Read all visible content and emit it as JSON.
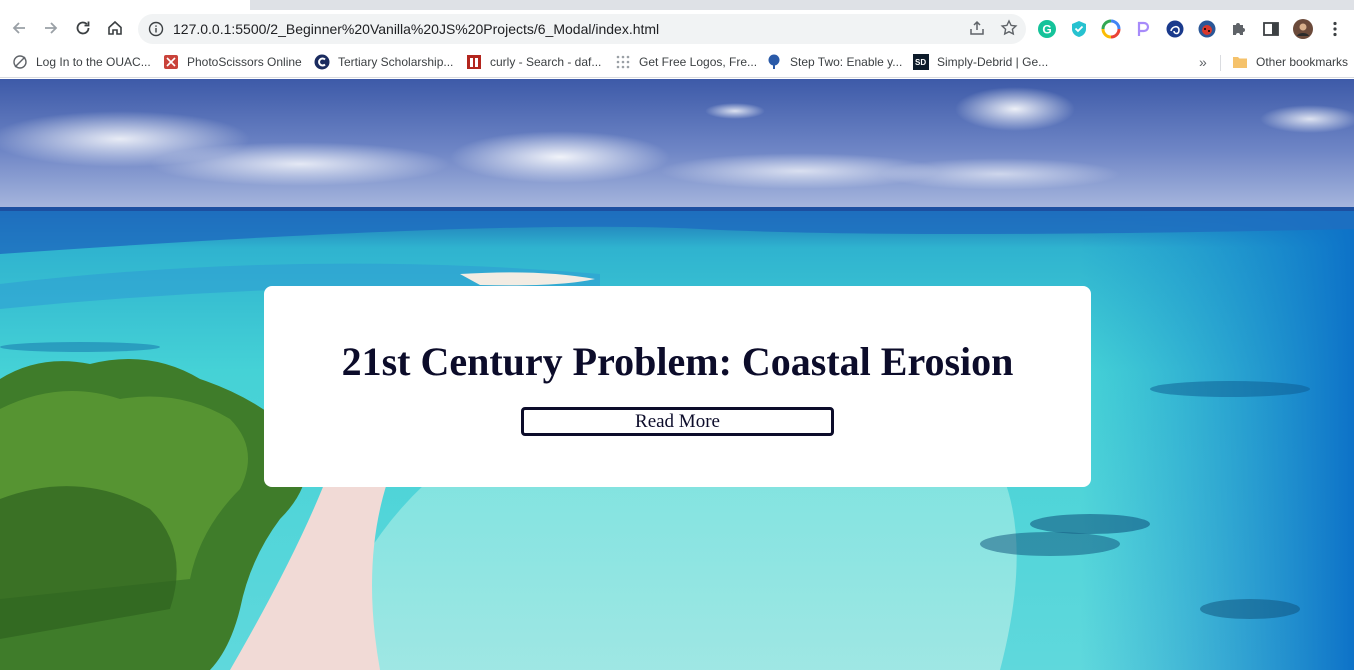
{
  "browser": {
    "url": "127.0.0.1:5500/2_Beginner%20Vanilla%20JS%20Projects/6_Modal/index.html",
    "bookmarks": [
      {
        "label": "Log In to the OUAC...",
        "icon": "ouac-icon"
      },
      {
        "label": "PhotoScissors Online",
        "icon": "photoscissors-icon"
      },
      {
        "label": "Tertiary Scholarship...",
        "icon": "tertiary-icon"
      },
      {
        "label": "curly - Search - daf...",
        "icon": "search-site-icon"
      },
      {
        "label": "Get Free Logos, Fre...",
        "icon": "apps-grid-icon"
      },
      {
        "label": "Step Two: Enable y...",
        "icon": "tree-icon"
      },
      {
        "label": "Simply-Debrid | Ge...",
        "icon": "simply-debrid-icon"
      }
    ],
    "overflow_label": "»",
    "other_bookmarks": "Other bookmarks"
  },
  "page": {
    "headline": "21st Century Problem: Coastal Erosion",
    "button_label": "Read More"
  },
  "colors": {
    "ink": "#0c0c2a",
    "card": "#ffffff"
  }
}
